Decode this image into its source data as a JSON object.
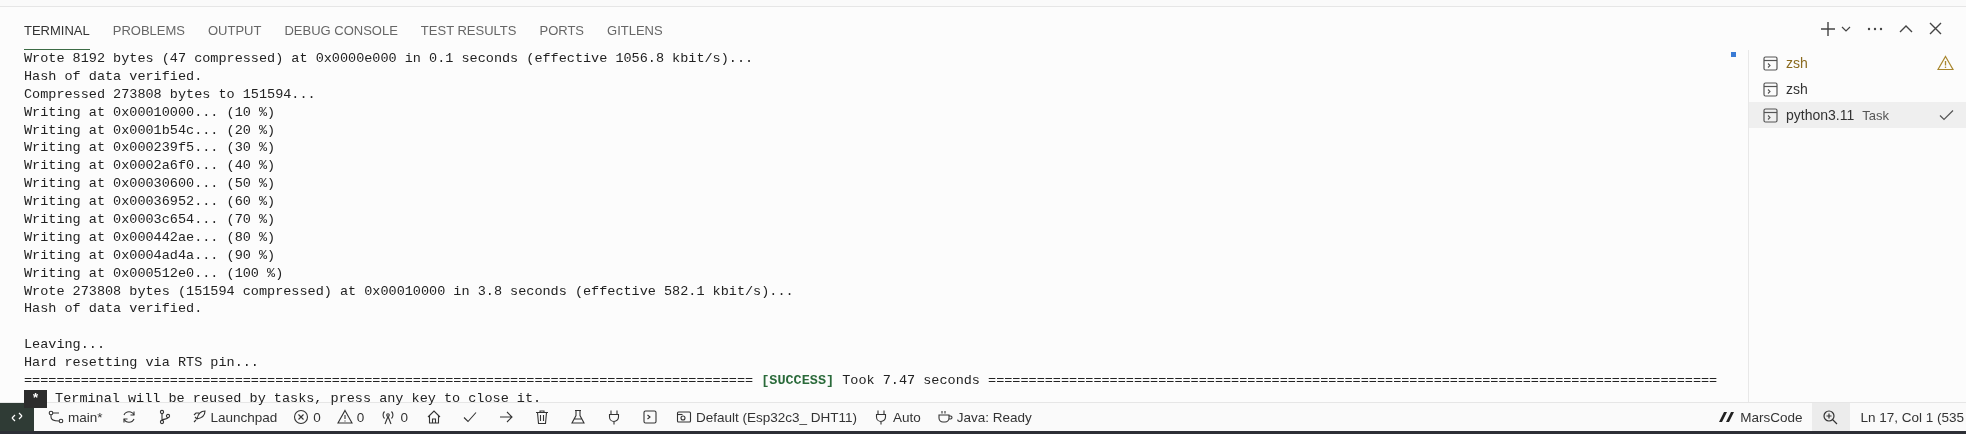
{
  "panel_tabs": [
    {
      "label": "TERMINAL",
      "selected": true
    },
    {
      "label": "PROBLEMS",
      "selected": false
    },
    {
      "label": "OUTPUT",
      "selected": false
    },
    {
      "label": "DEBUG CONSOLE",
      "selected": false
    },
    {
      "label": "TEST RESULTS",
      "selected": false
    },
    {
      "label": "PORTS",
      "selected": false
    },
    {
      "label": "GITLENS",
      "selected": false
    }
  ],
  "terminal": {
    "lines": [
      "Wrote 8192 bytes (47 compressed) at 0x0000e000 in 0.1 seconds (effective 1056.8 kbit/s)...",
      "Hash of data verified.",
      "Compressed 273808 bytes to 151594...",
      "Writing at 0x00010000... (10 %)",
      "Writing at 0x0001b54c... (20 %)",
      "Writing at 0x000239f5... (30 %)",
      "Writing at 0x0002a6f0... (40 %)",
      "Writing at 0x00030600... (50 %)",
      "Writing at 0x00036952... (60 %)",
      "Writing at 0x0003c654... (70 %)",
      "Writing at 0x000442ae... (80 %)",
      "Writing at 0x0004ad4a... (90 %)",
      "Writing at 0x000512e0... (100 %)",
      "Wrote 273808 bytes (151594 compressed) at 0x00010000 in 3.8 seconds (effective 582.1 kbit/s)...",
      "Hash of data verified."
    ],
    "tail_lines": [
      "Leaving...",
      "Hard resetting via RTS pin..."
    ],
    "result_line": {
      "left": "==========================================================================================",
      "tag": "[SUCCESS]",
      "text": "Took 7.47 seconds",
      "right": "=========================================================================================="
    },
    "notice": {
      "marker": "*",
      "text": "Terminal will be reused by tasks, press any key to close it."
    }
  },
  "terminal_list": [
    {
      "name": "zsh",
      "kind": "warning",
      "selected": false
    },
    {
      "name": "zsh",
      "kind": "plain",
      "selected": false
    },
    {
      "name": "python3.11",
      "description": "Task",
      "kind": "done",
      "selected": true
    }
  ],
  "status_bar": {
    "left": [
      {
        "kind": "labeled",
        "text": "main*"
      },
      {
        "kind": "icon_only"
      },
      {
        "kind": "icon_only"
      },
      {
        "kind": "labeled",
        "text": "Launchpad"
      },
      {
        "kind": "labeled",
        "text": "0"
      },
      {
        "kind": "labeled",
        "text": "0"
      },
      {
        "kind": "labeled",
        "text": "0"
      },
      {
        "kind": "icon_only"
      },
      {
        "kind": "icon_only"
      },
      {
        "kind": "icon_only"
      },
      {
        "kind": "icon_only"
      },
      {
        "kind": "icon_only"
      },
      {
        "kind": "icon_only"
      },
      {
        "kind": "icon_only"
      },
      {
        "kind": "labeled",
        "text": "Default (Esp32c3_ DHT11)"
      },
      {
        "kind": "labeled",
        "text": "Auto"
      },
      {
        "kind": "labeled",
        "text": "Java: Ready"
      }
    ],
    "right": [
      {
        "kind": "labeled",
        "text": "MarsCode"
      },
      {
        "kind": "icon_only",
        "highlighted": true
      },
      {
        "kind": "labeled",
        "text": "Ln 17, Col 1 (535"
      }
    ]
  }
}
